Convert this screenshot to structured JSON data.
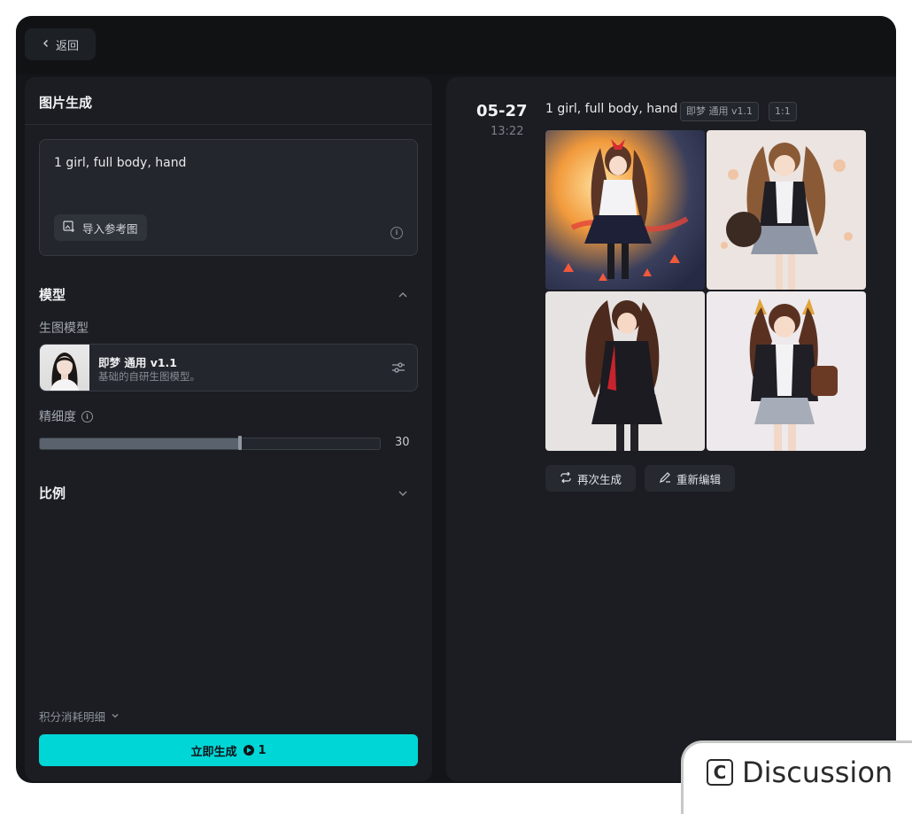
{
  "header": {
    "back_label": "返回"
  },
  "left": {
    "title": "图片生成",
    "prompt": "1 girl, full body, hand",
    "import_label": "导入参考图",
    "model_section": "模型",
    "model_sub_label": "生图模型",
    "model_name": "即梦 通用 v1.1",
    "model_desc": "基础的自研生图模型。",
    "detail_label": "精细度",
    "detail_value": "30",
    "detail_fraction": 0.59,
    "ratio_section": "比例",
    "points_label": "积分消耗明细",
    "generate_label": "立即生成",
    "generate_cost": "1",
    "accent": "#00d6d6"
  },
  "result": {
    "date": "05-27",
    "time": "13:22",
    "prompt": "1 girl, full body, hand",
    "model_tag": "即梦 通用 v1.1",
    "ratio_tag": "1:1",
    "regenerate_label": "再次生成",
    "reedit_label": "重新编辑"
  },
  "watermark": {
    "label": "Discussion"
  }
}
